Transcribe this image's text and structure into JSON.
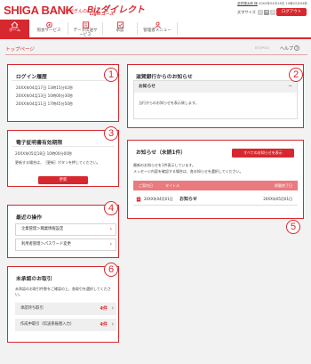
{
  "header": {
    "bank_name": "SHIGA BANK",
    "service_prefix": "しがぎんの",
    "service_name": "Bizダイレクト",
    "service_edition": "Lightコース",
    "user_name": "滋賀銀太郎 様",
    "last_login": "20XX年04月18日 10時02分04秒",
    "font_size_label": "文字サイズ",
    "font_sizes": [
      "小",
      "中",
      "大"
    ],
    "logout_label": "ログアウト"
  },
  "nav": {
    "items": [
      {
        "label": "ホーム",
        "icon": "home-icon",
        "active": true
      },
      {
        "label": "照会サービス",
        "icon": "inquiry-icon"
      },
      {
        "label": "データ伝送サービス",
        "icon": "data-transfer-icon"
      },
      {
        "label": "承認",
        "icon": "approval-icon"
      },
      {
        "label": "管理者メニュー",
        "icon": "admin-icon"
      }
    ]
  },
  "page": {
    "title": "トップページ",
    "code": "BTOP001",
    "help_label": "ヘルプ",
    "help_icon": "?"
  },
  "login_history": {
    "number": "1",
    "title": "ログイン履歴",
    "entries": [
      "20XX年04月17日 13時15分02秒",
      "20XX年04月13日 10時00分30秒",
      "20XX年04月11日 17時45分50秒"
    ]
  },
  "certificate": {
    "number": "3",
    "title": "電子証明書有効期限",
    "expiry": "20XX年05月18日 10時00分00秒",
    "note": "更新する場合は、［更新］ボタンを押してください。",
    "update_label": "更新"
  },
  "recent_ops": {
    "number": "4",
    "title": "最近の操作",
    "items": [
      "企業管理＞職業情報設定",
      "利用者管理＞パスワード変更"
    ]
  },
  "pending": {
    "number": "6",
    "title": "未承認のお取引",
    "note": "未承認のお取引件数をご確認の上、各取引を選択してください。",
    "items": [
      {
        "label": "承認待ち取引",
        "count": "4件"
      },
      {
        "label": "作成中取引（伝送系振替入力）",
        "count": "4件"
      }
    ]
  },
  "bank_notice": {
    "number": "2",
    "title": "滋賀銀行からのお知らせ",
    "header_label": "お知らせ",
    "collapse_icon": "－",
    "body": "当行からのお知らせを表示致します。"
  },
  "notices": {
    "number": "5",
    "title": "お知らせ（未読1件）",
    "show_all_label": "すべてのお知らせを表示",
    "note1": "最新のお知らせを1件表示しています。",
    "note2": "メッセージ内容を確認する場合は、各お知らせを選択してください。",
    "columns": [
      "ご案内日",
      "タイトル",
      "掲載終了日"
    ],
    "rows": [
      {
        "date": "20XX年04月01日",
        "title": "お知らせ",
        "end_date": "20XX年05月01日"
      }
    ]
  },
  "colors": {
    "brand": "#d7282f",
    "background": "#f2f2f2"
  }
}
